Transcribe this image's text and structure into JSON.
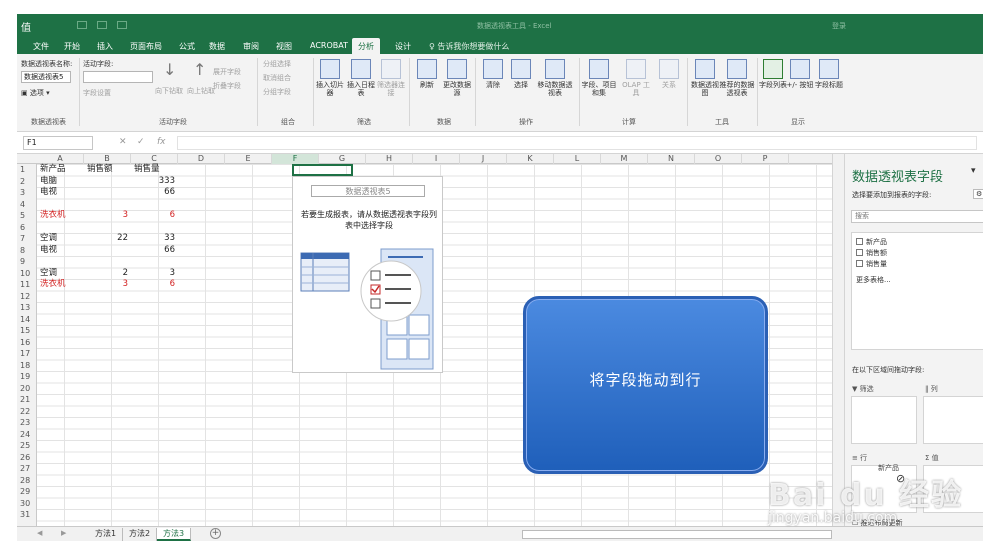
{
  "titlebar": {
    "title": "值",
    "center_text": "数据透视表工具 - Excel",
    "right_text": "登录"
  },
  "menu": [
    {
      "label": "文件",
      "active": false
    },
    {
      "label": "开始",
      "active": false
    },
    {
      "label": "插入",
      "active": false
    },
    {
      "label": "页面布局",
      "active": false
    },
    {
      "label": "公式",
      "active": false
    },
    {
      "label": "数据",
      "active": false
    },
    {
      "label": "审阅",
      "active": false
    },
    {
      "label": "视图",
      "active": false
    },
    {
      "label": "ACROBAT",
      "active": false
    },
    {
      "label": "分析",
      "active": true
    },
    {
      "label": "设计",
      "active": false
    }
  ],
  "tell_me": "♀ 告诉我你想要做什么",
  "ribbon": {
    "pivot_name_label": "数据透视表名称:",
    "pivot_name_value": "数据透视表5",
    "options_btn": "选项",
    "active_field_label": "活动字段:",
    "field_settings": "字段设置",
    "drill_down": "向下钻取",
    "drill_up": "向上钻取",
    "expand_field": "展开字段",
    "collapse_field": "折叠字段",
    "group_selection": "分组选择",
    "ungroup": "取消组合",
    "group_field": "分组字段",
    "insert_slicer": "插入切片器",
    "insert_timeline": "插入日程表",
    "filter_connections": "筛选器连接",
    "refresh": "刷新",
    "change_source": "更改数据源",
    "clear": "清除",
    "select": "选择",
    "move_pivot": "移动数据透视表",
    "fields_items": "字段、项目和集",
    "olap_tools": "OLAP 工具",
    "relationships": "关系",
    "pivot_chart": "数据透视图",
    "recommended": "推荐的数据透视表",
    "field_list": "字段列表",
    "pm_buttons": "+/- 按钮",
    "field_headers": "字段标题",
    "groups": [
      "数据透视表",
      "活动字段",
      "组合",
      "筛选",
      "数据",
      "操作",
      "计算",
      "工具",
      "显示"
    ]
  },
  "formula_bar": {
    "name_box": "F1",
    "fx": "fx",
    "cancel": "✕",
    "enter": "✓"
  },
  "columns": [
    "A",
    "B",
    "C",
    "D",
    "E",
    "F",
    "G",
    "H",
    "I",
    "J",
    "K",
    "L",
    "M",
    "N",
    "O",
    "P"
  ],
  "rows": [
    "1",
    "2",
    "3",
    "4",
    "5",
    "6",
    "7",
    "8",
    "9",
    "10",
    "11",
    "12",
    "13",
    "14",
    "15",
    "16",
    "17",
    "18",
    "19",
    "20",
    "21",
    "22",
    "23",
    "24",
    "25",
    "26",
    "27",
    "28",
    "29",
    "30",
    "31"
  ],
  "cells": [
    {
      "r": 1,
      "c": "A",
      "v": "新产品"
    },
    {
      "r": 1,
      "c": "B",
      "v": "销售额"
    },
    {
      "r": 1,
      "c": "C",
      "v": "销售量"
    },
    {
      "r": 2,
      "c": "A",
      "v": "电脑"
    },
    {
      "r": 2,
      "c": "C",
      "v": "333",
      "num": true
    },
    {
      "r": 3,
      "c": "A",
      "v": "电视"
    },
    {
      "r": 3,
      "c": "C",
      "v": "66",
      "num": true
    },
    {
      "r": 5,
      "c": "A",
      "v": "洗衣机",
      "red": true
    },
    {
      "r": 5,
      "c": "B",
      "v": "3",
      "num": true,
      "red": true
    },
    {
      "r": 5,
      "c": "C",
      "v": "6",
      "num": true,
      "red": true
    },
    {
      "r": 7,
      "c": "A",
      "v": "空调"
    },
    {
      "r": 7,
      "c": "B",
      "v": "22",
      "num": true
    },
    {
      "r": 7,
      "c": "C",
      "v": "33",
      "num": true
    },
    {
      "r": 8,
      "c": "A",
      "v": "电视"
    },
    {
      "r": 8,
      "c": "C",
      "v": "66",
      "num": true
    },
    {
      "r": 10,
      "c": "A",
      "v": "空调"
    },
    {
      "r": 10,
      "c": "B",
      "v": "2",
      "num": true
    },
    {
      "r": 10,
      "c": "C",
      "v": "3",
      "num": true
    },
    {
      "r": 11,
      "c": "A",
      "v": "洗衣机",
      "red": true
    },
    {
      "r": 11,
      "c": "B",
      "v": "3",
      "num": true,
      "red": true
    },
    {
      "r": 11,
      "c": "C",
      "v": "6",
      "num": true,
      "red": true
    }
  ],
  "pivot_placeholder": {
    "title": "数据透视表5",
    "desc": "若要生成报表，请从数据透视表字段列表中选择字段"
  },
  "overlay_caption": "将字段拖动到行",
  "sheet_tabs": [
    {
      "label": "方法1",
      "active": false
    },
    {
      "label": "方法2",
      "active": false
    },
    {
      "label": "方法3",
      "active": true
    }
  ],
  "panel": {
    "title": "数据透视表字段",
    "subtitle": "选择要添加到报表的字段:",
    "search_placeholder": "搜索",
    "fields": [
      "新产品",
      "销售额",
      "销售量"
    ],
    "more_tables": "更多表格...",
    "drag_label": "在以下区域间拖动字段:",
    "filters": "筛选",
    "columns": "列",
    "rows": "行",
    "values": "值",
    "drag_item": "新产品",
    "defer": "推迟布局更新"
  },
  "watermark": {
    "brand": "Bai du 经验",
    "url": "jingyan.baidu.com"
  }
}
